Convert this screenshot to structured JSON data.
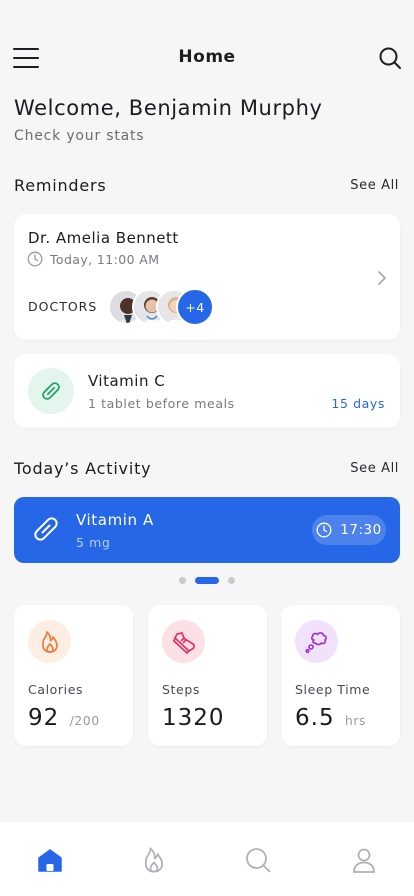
{
  "header": {
    "title": "Home",
    "menu_icon": "hamburger-menu-icon",
    "search_icon": "search-icon"
  },
  "welcome": {
    "greeting": "Welcome, Benjamin Murphy",
    "subtitle": "Check your stats"
  },
  "reminders": {
    "title": "Reminders",
    "see_all": "See All",
    "doctor_card": {
      "name": "Dr. Amelia Bennett",
      "time": "Today, 11:00 AM",
      "doctors_label": "DOCTORS",
      "more_count": "+4"
    },
    "vitamin_card": {
      "name": "Vitamin C",
      "description": "1 tablet before meals",
      "duration": "15 days",
      "accent": "#1fa56b"
    }
  },
  "activity": {
    "title": "Today’s Activity",
    "see_all": "See All",
    "card": {
      "name": "Vitamin A",
      "dose": "5 mg",
      "time": "17:30",
      "color": "#2667e8"
    },
    "pager": {
      "count": 3,
      "active": 1
    }
  },
  "stats": [
    {
      "label": "Calories",
      "value": "92",
      "unit": "/200",
      "icon": "flame-icon",
      "color": "#f07a3a"
    },
    {
      "label": "Steps",
      "value": "1320",
      "unit": "",
      "icon": "sneaker-icon",
      "color": "#e0336a"
    },
    {
      "label": "Sleep Time",
      "value": "6.5",
      "unit": "hrs",
      "icon": "dream-bubble-icon",
      "color": "#9b30d9"
    }
  ],
  "tabbar": {
    "items": [
      "home-icon",
      "flame-icon",
      "search-icon",
      "profile-icon"
    ],
    "active": 0,
    "active_color": "#2667e8",
    "inactive_color": "#b0b0b6"
  }
}
